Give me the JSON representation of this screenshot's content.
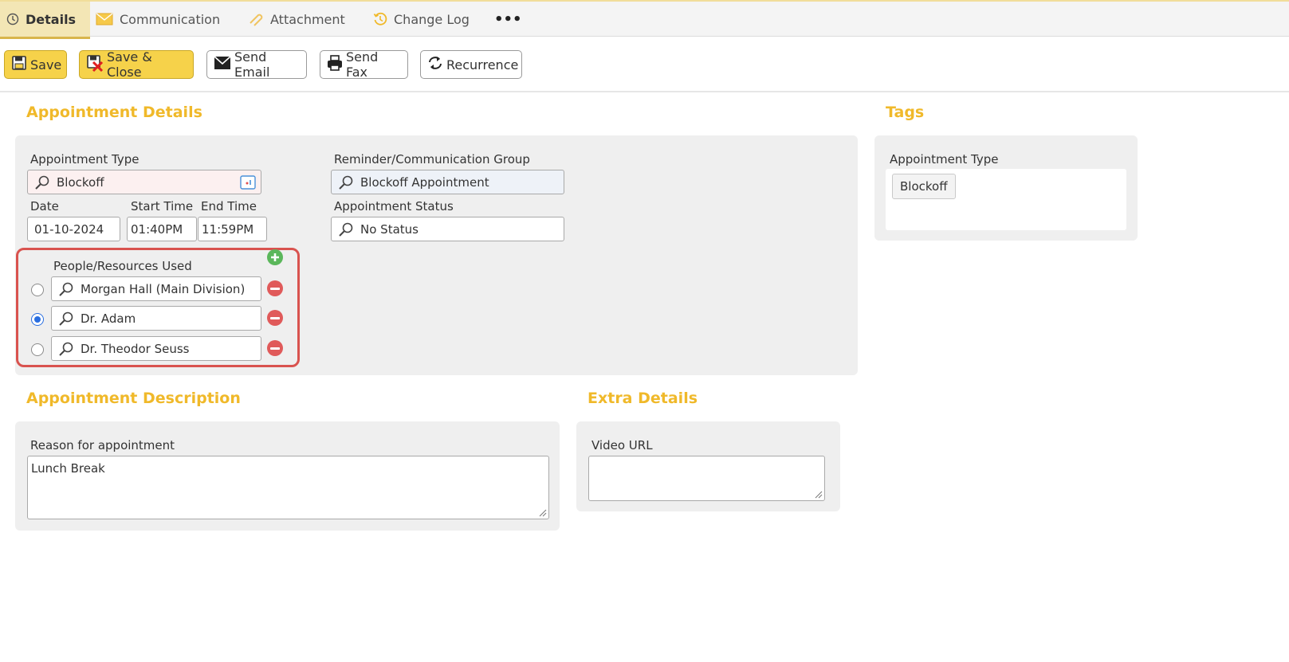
{
  "tabs": [
    {
      "label": "Details",
      "icon": "clock-icon"
    },
    {
      "label": "Communication",
      "icon": "envelope-icon"
    },
    {
      "label": "Attachment",
      "icon": "paperclip-icon"
    },
    {
      "label": "Change Log",
      "icon": "history-icon"
    },
    {
      "label": "•••",
      "icon": "more-icon"
    }
  ],
  "toolbar": {
    "save": "Save",
    "save_close": "Save & Close",
    "send_email": "Send Email",
    "send_fax": "Send Fax",
    "recurrence": "Recurrence"
  },
  "appointment_details": {
    "title": "Appointment Details",
    "type_label": "Appointment Type",
    "type_value": "Blockoff",
    "date_label": "Date",
    "date_value": "01-10-2024",
    "start_label": "Start Time",
    "start_value": "01:40PM",
    "end_label": "End Time",
    "end_value": "11:59PM",
    "group_label": "Reminder/Communication Group",
    "group_value": "Blockoff Appointment",
    "status_label": "Appointment Status",
    "status_value": "No Status",
    "people_label": "People/Resources Used",
    "people": [
      {
        "name": "Morgan Hall (Main Division)",
        "selected": false
      },
      {
        "name": "Dr. Adam",
        "selected": true
      },
      {
        "name": "Dr. Theodor Seuss",
        "selected": false
      }
    ]
  },
  "tags": {
    "title": "Tags",
    "type_label": "Appointment Type",
    "chip": "Blockoff"
  },
  "description": {
    "title": "Appointment Description",
    "reason_label": "Reason for appointment",
    "reason_value": "Lunch Break"
  },
  "extra": {
    "title": "Extra Details",
    "video_label": "Video URL",
    "video_value": ""
  },
  "colors": {
    "accent": "#f0b92a",
    "highlight_border": "#d9534f",
    "selected_radio": "#2a6ee0"
  }
}
